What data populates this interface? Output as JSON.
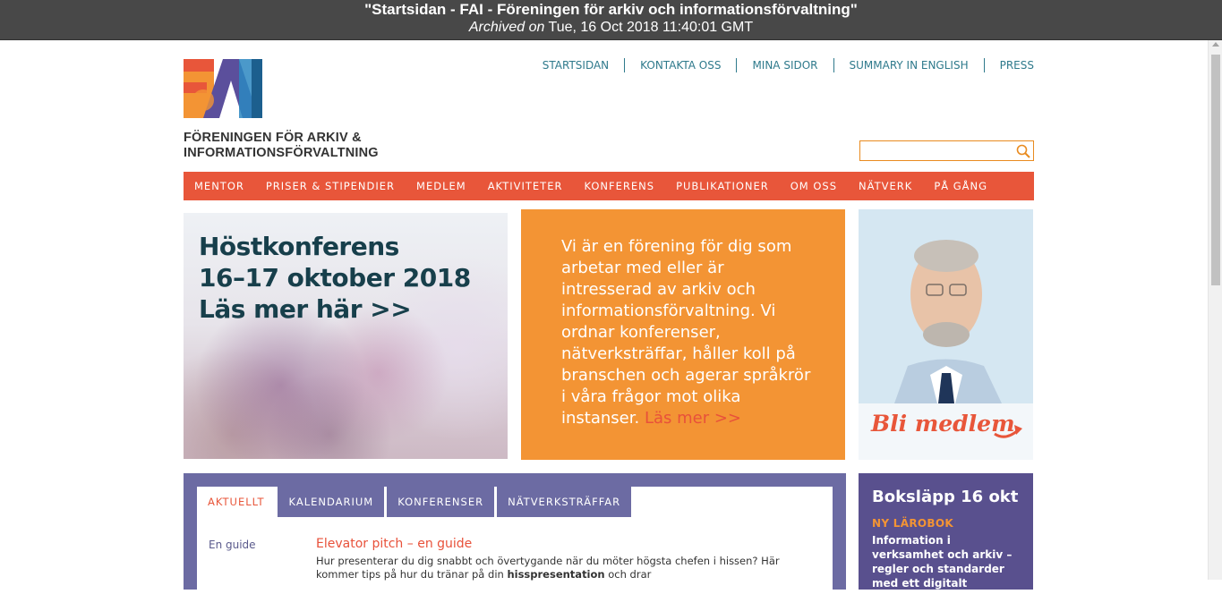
{
  "archive": {
    "title": "\"Startsidan - FAI - Föreningen för arkiv och informationsförvaltning\"",
    "archived_label": "Archived on",
    "archived_date": "Tue, 16 Oct 2018 11:40:01 GMT"
  },
  "logo": {
    "line1": "FÖRENINGEN FÖR ARKIV &",
    "line2": "INFORMATIONSFÖRVALTNING",
    "mark_text": "FAI",
    "colors": [
      "#f39434",
      "#5b4f9c",
      "#2c87c1",
      "#e8563a"
    ]
  },
  "topnav": [
    "STARTSIDAN",
    "KONTAKTA OSS",
    "MINA SIDOR",
    "SUMMARY IN ENGLISH",
    "PRESS"
  ],
  "search": {
    "value": "",
    "placeholder": ""
  },
  "mainnav": [
    "MENTOR",
    "PRISER & STIPENDIER",
    "MEDLEM",
    "AKTIVITETER",
    "KONFERENS",
    "PUBLIKATIONER",
    "OM OSS",
    "NÄTVERK",
    "PÅ GÅNG"
  ],
  "hero": {
    "line1": "Höstkonferens",
    "line2": "16–17 oktober 2018",
    "line3": "Läs mer här >>"
  },
  "intro": {
    "text": "Vi är en förening för dig som arbetar med eller är intresserad av arkiv och informationsförvaltning. Vi ordnar konferenser, nätverksträffar, håller koll på branschen och agerar språkrör i våra frågor mot olika instanser.",
    "more_label": "Läs mer >>"
  },
  "member": {
    "cta": "Bli medlem"
  },
  "news": {
    "tabs": [
      "AKTUELLT",
      "KALENDARIUM",
      "KONFERENSER",
      "NÄTVERKSTRÄFFAR"
    ],
    "active_tab": "AKTUELLT",
    "items": [
      {
        "category": "En guide",
        "title": "Elevator pitch – en guide",
        "body_line1": "Hur presenterar du dig snabbt och övertygande när du möter högsta chefen i hissen? Här",
        "body_line2_start": "kommer tips på hur du tränar på din ",
        "body_line2_bold": "hisspresentation",
        "body_line2_end": " och drar"
      }
    ]
  },
  "book": {
    "title": "Boksläpp 16 okt",
    "subtitle": "NY LÄROBOK",
    "text": "Information i verksamhet och arkiv – regler och standarder med ett digitalt"
  },
  "colors": {
    "accent_red": "#e8563a",
    "accent_orange": "#f39434",
    "purple": "#6c6ba3",
    "dark_purple": "#59508e",
    "link_teal": "#2f7a8c"
  }
}
